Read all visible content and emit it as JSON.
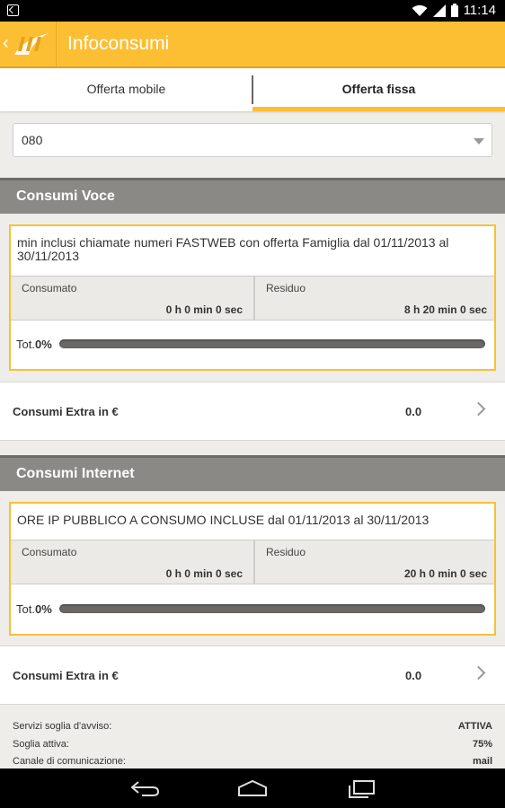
{
  "status_bar": {
    "time": "11:14"
  },
  "app_bar": {
    "title": "Infoconsumi",
    "back_icon": "back-chevron-icon",
    "logo_icon": "fastweb-logo-icon",
    "accent_color": "#fcbf33"
  },
  "tabs": [
    {
      "label": "Offerta mobile",
      "active": false
    },
    {
      "label": "Offerta fissa",
      "active": true
    }
  ],
  "selector": {
    "value": "080"
  },
  "sections": [
    {
      "title": "Consumi Voce",
      "description": "min inclusi chiamate numeri FASTWEB con offerta Famiglia dal 01/11/2013 al 30/11/2013",
      "consumed_label": "Consumato",
      "consumed_value": "0 h 0 min 0 sec",
      "remaining_label": "Residuo",
      "remaining_value": "8 h 20 min 0 sec",
      "total_label": "Tot.",
      "total_percent": "0%",
      "extra_label": "Consumi Extra in €",
      "extra_value": "0.0"
    },
    {
      "title": "Consumi Internet",
      "description": "ORE IP PUBBLICO A CONSUMO INCLUSE dal 01/11/2013 al 30/11/2013",
      "consumed_label": "Consumato",
      "consumed_value": "0 h 0 min 0 sec",
      "remaining_label": "Residuo",
      "remaining_value": "20 h 0 min 0 sec",
      "total_label": "Tot.",
      "total_percent": "0%",
      "extra_label": "Consumi Extra in €",
      "extra_value": "0.0"
    }
  ],
  "info": [
    {
      "label": "Servizi soglia d'avviso:",
      "value": "ATTIVA"
    },
    {
      "label": "Soglia attiva:",
      "value": "75%"
    },
    {
      "label": "Canale di comunicazione:",
      "value": "mail"
    }
  ],
  "nav_bar": {
    "icons": [
      "back-icon",
      "home-icon",
      "recent-apps-icon"
    ]
  }
}
